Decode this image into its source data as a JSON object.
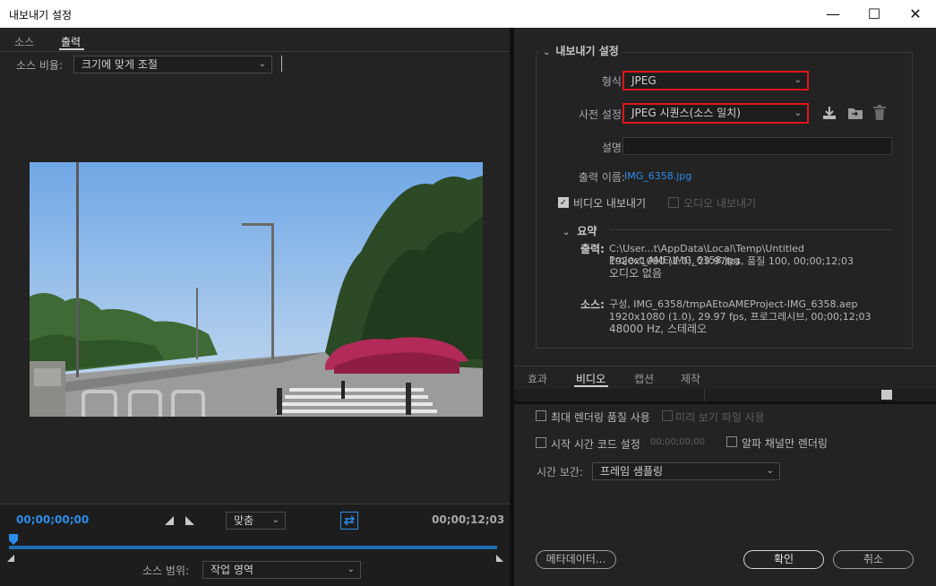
{
  "window": {
    "title": "내보내기 설정",
    "minimize": "—",
    "maximize": "☐",
    "close": "✕"
  },
  "left": {
    "tabs": [
      "소스",
      "출력"
    ],
    "active_tab": 1,
    "source_ratio_label": "소스 비율:",
    "source_ratio_value": "크기에 맞게 조절"
  },
  "timeline": {
    "current_tc": "00;00;00;00",
    "end_tc": "00;00;12;03",
    "fit_value": "맞춤",
    "source_range_label": "소스 범위:",
    "source_range_value": "작업 영역",
    "progress": 0.0
  },
  "export": {
    "section_title": "내보내기 설정",
    "format_label": "형식:",
    "format_value": "JPEG",
    "preset_label": "사전 설정:",
    "preset_value": "JPEG 시퀀스(소스 일치)",
    "comment_label": "설명:",
    "comment_value": "",
    "output_name_label": "출력 이름:",
    "output_name_value": "IMG_6358.jpg",
    "export_video_label": "비디오 내보내기",
    "export_video_checked": true,
    "export_audio_label": "오디오 내보내기",
    "export_audio_checked": false
  },
  "summary": {
    "title": "요약",
    "output_label": "출력:",
    "output_lines": [
      "C:\\User...t\\AppData\\Local\\Temp\\Untitled Project_AME\\IMG_6358.jpg",
      "1920x1080 (1.0), 29.97fps, 품질 100, 00;00;12;03",
      "오디오 없음"
    ],
    "source_label": "소스:",
    "source_lines": [
      "구성, IMG_6358/tmpAEtoAMEProject-IMG_6358.aep",
      "1920x1080 (1.0), 29.97 fps, 프로그레시브, 00;00;12;03",
      "48000 Hz, 스테레오"
    ]
  },
  "right_tabs": [
    "효과",
    "비디오",
    "캡션",
    "제작"
  ],
  "right_active_tab": 1,
  "options": {
    "max_render_quality": "최대 렌더링 품질 사용",
    "use_previews": "미리 보기 파일 사용",
    "start_timecode": "시작 시간 코드 설정",
    "start_timecode_value": "00;00;00;00",
    "alpha_only": "알파 채널만 렌더링",
    "time_interp_label": "시간 보간:",
    "time_interp_value": "프레임 샘플링"
  },
  "buttons": {
    "metadata": "메타데이터...",
    "ok": "확인",
    "cancel": "취소"
  },
  "colors": {
    "accent": "#2d8ceb",
    "highlight": "#e0151b",
    "link": "#2d8ceb"
  },
  "icons": [
    "download-icon",
    "import-icon",
    "trash-icon",
    "chevron-down-icon",
    "loop-icon",
    "mark-in-icon",
    "mark-out-icon",
    "playhead-icon"
  ]
}
